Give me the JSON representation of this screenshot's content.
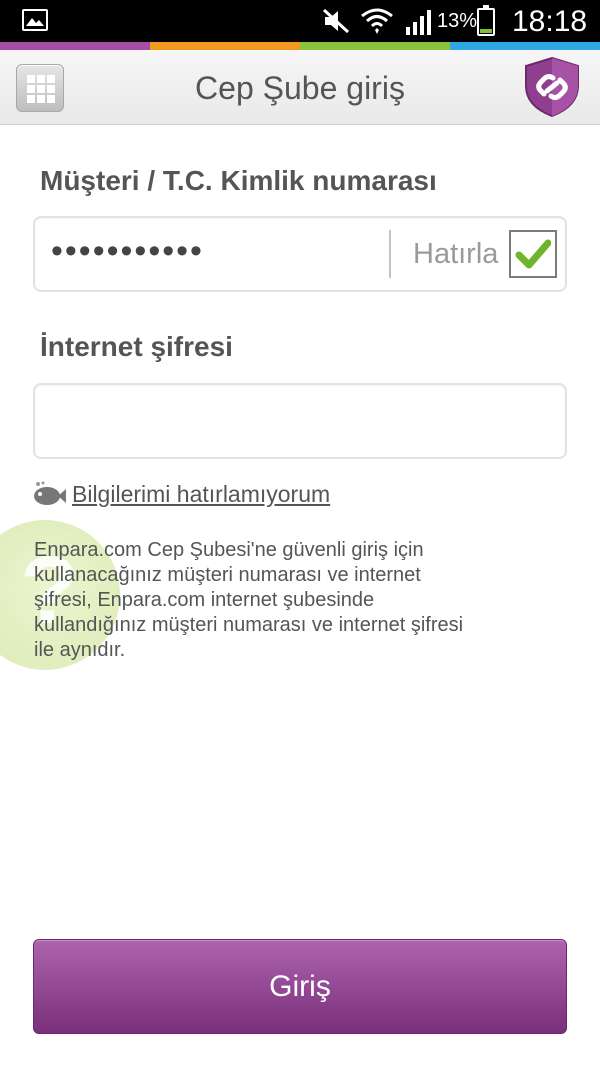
{
  "status_bar": {
    "battery_percent": "13%",
    "time": "18:18",
    "icons": [
      "gallery-icon",
      "mute-icon",
      "wifi-icon",
      "signal-icon",
      "battery-icon"
    ]
  },
  "color_strip": [
    "#a54ea5",
    "#f29a1f",
    "#8ac43f",
    "#2fa7e0"
  ],
  "header": {
    "title": "Cep Şube giriş",
    "menu_icon": "grid-icon",
    "security_icon": "shield-link-icon"
  },
  "form": {
    "customer_label": "Müşteri / T.C. Kimlik numarası",
    "customer_value": "•••••••••••",
    "remember_label": "Hatırla",
    "remember_checked": true,
    "password_label": "İnternet şifresi",
    "password_value": "",
    "forgot_link": "Bilgilerimi hatırlamıyorum",
    "info_text": "Enpara.com Cep Şubesi'ne güvenli giriş için kullanacağınız müşteri numarası ve internet şifresi, Enpara.com internet şubesinde kullandığınız müşteri numarası ve internet şifresi ile aynıdır."
  },
  "help": {
    "symbol": "?"
  },
  "login_button": "Giriş",
  "colors": {
    "brand_purple": "#8e3f8e",
    "check_green": "#6fb52c",
    "text_gray": "#555555"
  }
}
